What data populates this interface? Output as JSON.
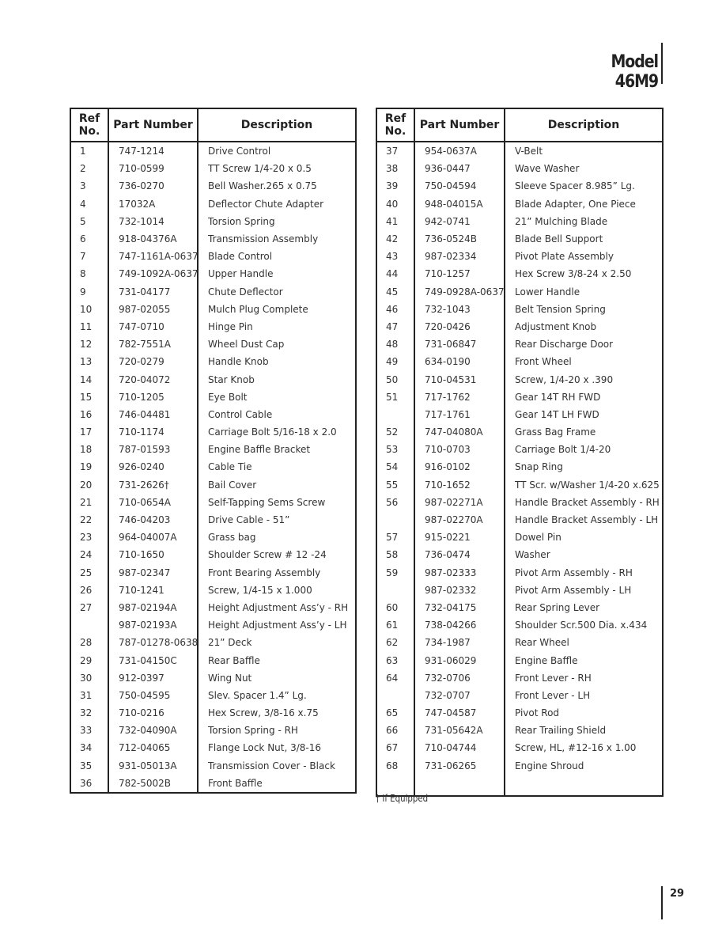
{
  "header": {
    "model_title": "Model 46M9"
  },
  "columns": {
    "ref": "Ref No.",
    "ref_line1": "Ref",
    "ref_line2": "No.",
    "part_number": "Part Number",
    "description": "Description"
  },
  "left_table": [
    {
      "ref": "1",
      "part": "747-1214",
      "desc": "Drive Control"
    },
    {
      "ref": "2",
      "part": "710-0599",
      "desc": "TT Screw 1/4-20 x 0.5"
    },
    {
      "ref": "3",
      "part": "736-0270",
      "desc": "Bell Washer.265 x 0.75"
    },
    {
      "ref": "4",
      "part": "17032A",
      "desc": "Deflector Chute Adapter"
    },
    {
      "ref": "5",
      "part": "732-1014",
      "desc": "Torsion Spring"
    },
    {
      "ref": "6",
      "part": "918-04376A",
      "desc": "Transmission Assembly"
    },
    {
      "ref": "7",
      "part": "747-1161A-0637",
      "desc": "Blade Control"
    },
    {
      "ref": "8",
      "part": "749-1092A-0637",
      "desc": "Upper Handle"
    },
    {
      "ref": "9",
      "part": "731-04177",
      "desc": "Chute Deflector"
    },
    {
      "ref": "10",
      "part": "987-02055",
      "desc": "Mulch Plug Complete"
    },
    {
      "ref": "11",
      "part": "747-0710",
      "desc": "Hinge Pin"
    },
    {
      "ref": "12",
      "part": "782-7551A",
      "desc": "Wheel Dust Cap"
    },
    {
      "ref": "13",
      "part": "720-0279",
      "desc": "Handle Knob"
    },
    {
      "ref": "14",
      "part": "720-04072",
      "desc": "Star Knob"
    },
    {
      "ref": "15",
      "part": "710-1205",
      "desc": "Eye Bolt"
    },
    {
      "ref": "16",
      "part": "746-04481",
      "desc": "Control Cable"
    },
    {
      "ref": "17",
      "part": "710-1174",
      "desc": "Carriage Bolt 5/16-18 x 2.0"
    },
    {
      "ref": "18",
      "part": "787-01593",
      "desc": "Engine Baffle Bracket"
    },
    {
      "ref": "19",
      "part": "926-0240",
      "desc": "Cable Tie"
    },
    {
      "ref": "20",
      "part": "731-2626†",
      "desc": "Bail Cover"
    },
    {
      "ref": "21",
      "part": "710-0654A",
      "desc": "Self-Tapping Sems Screw"
    },
    {
      "ref": "22",
      "part": "746-04203",
      "desc": "Drive Cable - 51”"
    },
    {
      "ref": "23",
      "part": "964-04007A",
      "desc": "Grass bag"
    },
    {
      "ref": "24",
      "part": "710-1650",
      "desc": "Shoulder Screw # 12 -24"
    },
    {
      "ref": "25",
      "part": "987-02347",
      "desc": "Front Bearing Assembly"
    },
    {
      "ref": "26",
      "part": "710-1241",
      "desc": "Screw, 1/4-15 x 1.000"
    },
    {
      "ref": "27",
      "part": "987-02194A",
      "desc": "Height Adjustment Ass’y - RH"
    },
    {
      "ref": "",
      "part": "987-02193A",
      "desc": "Height Adjustment Ass’y - LH"
    },
    {
      "ref": "28",
      "part": "787-01278-0638",
      "desc": "21” Deck"
    },
    {
      "ref": "29",
      "part": "731-04150C",
      "desc": "Rear Baffle"
    },
    {
      "ref": "30",
      "part": "912-0397",
      "desc": "Wing Nut"
    },
    {
      "ref": "31",
      "part": "750-04595",
      "desc": "Slev. Spacer 1.4” Lg."
    },
    {
      "ref": "32",
      "part": "710-0216",
      "desc": "Hex Screw, 3/8-16 x.75"
    },
    {
      "ref": "33",
      "part": "732-04090A",
      "desc": "Torsion Spring - RH"
    },
    {
      "ref": "34",
      "part": "712-04065",
      "desc": "Flange Lock Nut, 3/8-16"
    },
    {
      "ref": "35",
      "part": "931-05013A",
      "desc": "Transmission Cover - Black"
    },
    {
      "ref": "36",
      "part": "782-5002B",
      "desc": "Front Baffle"
    }
  ],
  "right_table": [
    {
      "ref": "37",
      "part": "954-0637A",
      "desc": "V-Belt"
    },
    {
      "ref": "38",
      "part": "936-0447",
      "desc": "Wave Washer"
    },
    {
      "ref": "39",
      "part": "750-04594",
      "desc": "Sleeve Spacer 8.985” Lg."
    },
    {
      "ref": "40",
      "part": "948-04015A",
      "desc": "Blade Adapter, One Piece"
    },
    {
      "ref": "41",
      "part": "942-0741",
      "desc": "21” Mulching Blade"
    },
    {
      "ref": "42",
      "part": "736-0524B",
      "desc": "Blade Bell Support"
    },
    {
      "ref": "43",
      "part": "987-02334",
      "desc": "Pivot Plate Assembly"
    },
    {
      "ref": "44",
      "part": "710-1257",
      "desc": "Hex Screw 3/8-24 x 2.50"
    },
    {
      "ref": "45",
      "part": "749-0928A-0637",
      "desc": "Lower Handle"
    },
    {
      "ref": "46",
      "part": "732-1043",
      "desc": "Belt Tension Spring"
    },
    {
      "ref": "47",
      "part": "720-0426",
      "desc": "Adjustment Knob"
    },
    {
      "ref": "48",
      "part": "731-06847",
      "desc": "Rear Discharge Door"
    },
    {
      "ref": "49",
      "part": "634-0190",
      "desc": "Front Wheel"
    },
    {
      "ref": "50",
      "part": "710-04531",
      "desc": "Screw, 1/4-20 x .390"
    },
    {
      "ref": "51",
      "part": "717-1762",
      "desc": "Gear 14T RH FWD"
    },
    {
      "ref": "",
      "part": "717-1761",
      "desc": "Gear 14T LH FWD"
    },
    {
      "ref": "52",
      "part": "747-04080A",
      "desc": "Grass Bag Frame"
    },
    {
      "ref": "53",
      "part": "710-0703",
      "desc": "Carriage Bolt 1/4-20"
    },
    {
      "ref": "54",
      "part": "916-0102",
      "desc": "Snap Ring"
    },
    {
      "ref": "55",
      "part": "710-1652",
      "desc": "TT Scr. w/Washer 1/4-20 x.625"
    },
    {
      "ref": "56",
      "part": "987-02271A",
      "desc": "Handle Bracket Assembly - RH"
    },
    {
      "ref": "",
      "part": "987-02270A",
      "desc": "Handle Bracket Assembly - LH"
    },
    {
      "ref": "57",
      "part": "915-0221",
      "desc": "Dowel Pin"
    },
    {
      "ref": "58",
      "part": "736-0474",
      "desc": "Washer"
    },
    {
      "ref": "59",
      "part": "987-02333",
      "desc": "Pivot Arm Assembly - RH"
    },
    {
      "ref": "",
      "part": "987-02332",
      "desc": "Pivot Arm Assembly - LH"
    },
    {
      "ref": "60",
      "part": "732-04175",
      "desc": "Rear Spring Lever"
    },
    {
      "ref": "61",
      "part": "738-04266",
      "desc": "Shoulder Scr.500 Dia. x.434"
    },
    {
      "ref": "62",
      "part": "734-1987",
      "desc": "Rear Wheel"
    },
    {
      "ref": "63",
      "part": "931-06029",
      "desc": "Engine Baffle"
    },
    {
      "ref": "64",
      "part": "732-0706",
      "desc": "Front Lever - RH"
    },
    {
      "ref": "",
      "part": "732-0707",
      "desc": "Front Lever - LH"
    },
    {
      "ref": "65",
      "part": "747-04587",
      "desc": "Pivot Rod"
    },
    {
      "ref": "66",
      "part": "731-05642A",
      "desc": "Rear Trailing Shield"
    },
    {
      "ref": "67",
      "part": "710-04744",
      "desc": "Screw, HL, #12-16 x 1.00"
    },
    {
      "ref": "68",
      "part": "731-06265",
      "desc": "Engine Shroud"
    }
  ],
  "footnote": "† If Equipped",
  "page_number": "29"
}
